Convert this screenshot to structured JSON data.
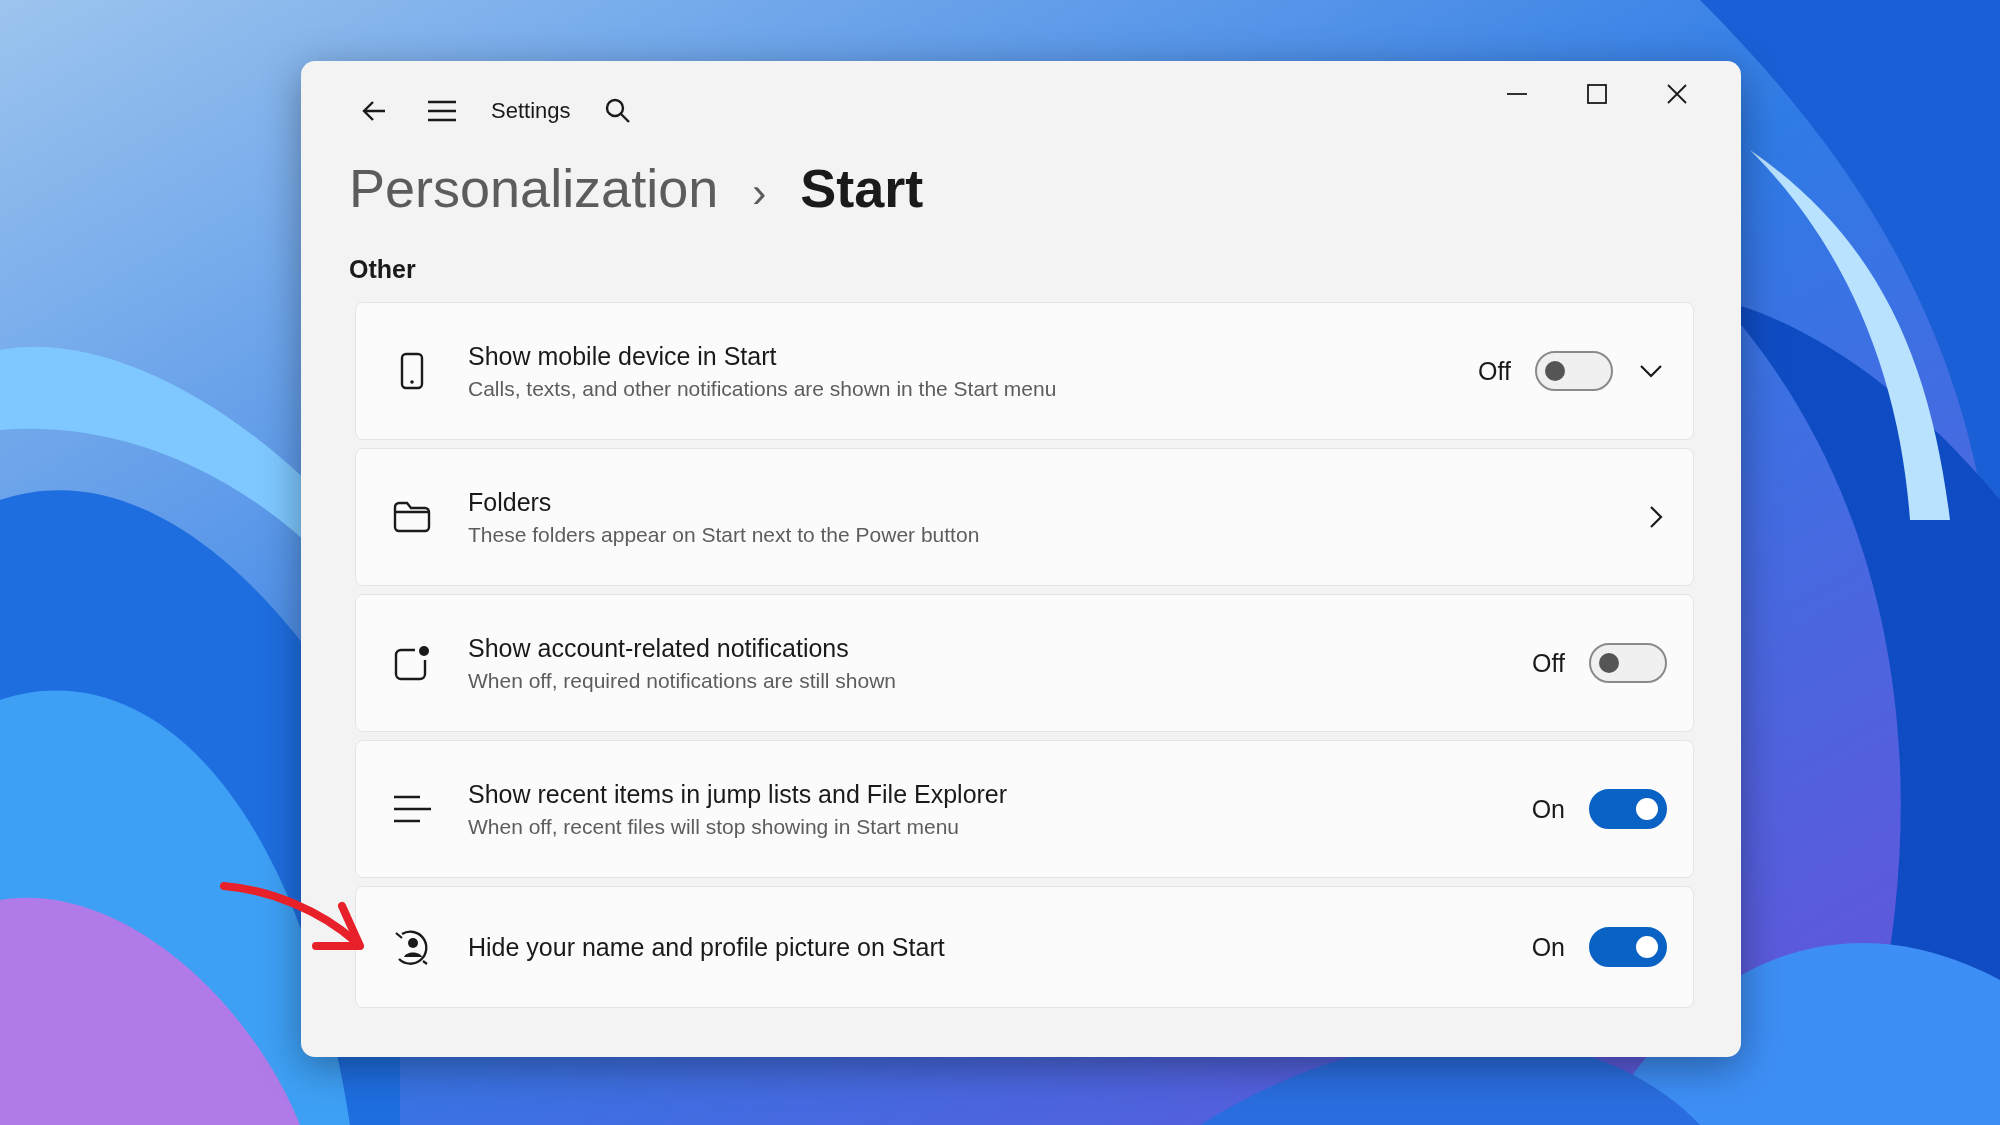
{
  "window": {
    "title": "Settings"
  },
  "breadcrumb": {
    "parent": "Personalization",
    "separator": "›",
    "current": "Start"
  },
  "section": "Other",
  "items": [
    {
      "kind": "toggle",
      "title": "Show mobile device in Start",
      "description": "Calls, texts, and other notifications are shown in the Start menu",
      "state_label": "Off",
      "on": false,
      "expandable": true
    },
    {
      "kind": "link",
      "title": "Folders",
      "description": "These folders appear on Start next to the Power button"
    },
    {
      "kind": "toggle",
      "title": "Show account-related notifications",
      "description": "When off, required notifications are still shown",
      "state_label": "Off",
      "on": false,
      "expandable": false
    },
    {
      "kind": "toggle",
      "title": "Show recent items in jump lists and File Explorer",
      "description": "When off, recent files will stop showing in Start menu",
      "state_label": "On",
      "on": true,
      "expandable": false
    },
    {
      "kind": "toggle",
      "title": "Hide your name and profile picture on Start",
      "state_label": "On",
      "on": true,
      "expandable": false
    }
  ]
}
